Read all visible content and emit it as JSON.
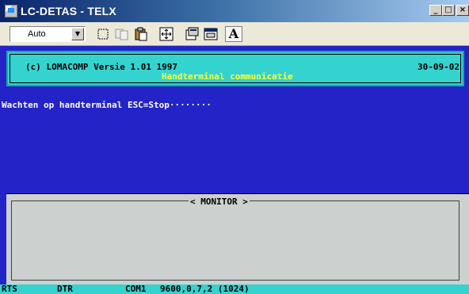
{
  "window": {
    "title": "LC-DETAS - TELX",
    "minimize_label": "_",
    "maximize_label": "□",
    "close_label": "×"
  },
  "toolbar": {
    "font_select_value": "Auto",
    "icons": [
      "select-icon",
      "copy-icon",
      "paste-icon",
      "fullscreen-icon",
      "properties-icon",
      "background-icon",
      "font-icon"
    ],
    "font_button_label": "A"
  },
  "terminal": {
    "header": {
      "copyright": "(c) LOMACOMP Versie 1.01 1997",
      "date": "30-09-02",
      "subtitle": "Handterminal communicatie"
    },
    "wait_message": "Wachten op handterminal ESC=Stop········",
    "monitor_title": "< MONITOR >",
    "status": {
      "rts": "RTS",
      "dtr": "DTR",
      "port": "COM1",
      "params": "9600,0,7,2 (1024)"
    }
  },
  "colors": {
    "terminal_bg": "#2323c8",
    "header_bg": "#34d3d0",
    "subtitle": "#ffff33",
    "monitor_bg": "#ccd1cf"
  }
}
